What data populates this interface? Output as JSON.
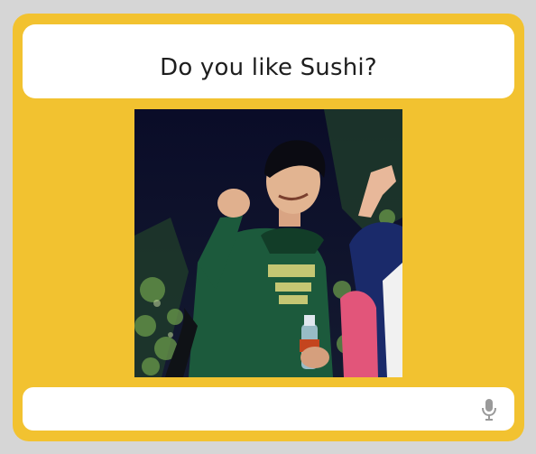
{
  "question": {
    "text": "Do you like Sushi?"
  },
  "photo": {
    "sweatshirt_color": "#1c5a3c",
    "background_color": "#0b0e2b"
  },
  "answer": {
    "value": "",
    "placeholder": ""
  },
  "icons": {
    "mic": "microphone-icon"
  },
  "colors": {
    "frame": "#d6d6d6",
    "panel": "#f2c230",
    "card": "#ffffff",
    "mic": "#9a9a9a"
  }
}
